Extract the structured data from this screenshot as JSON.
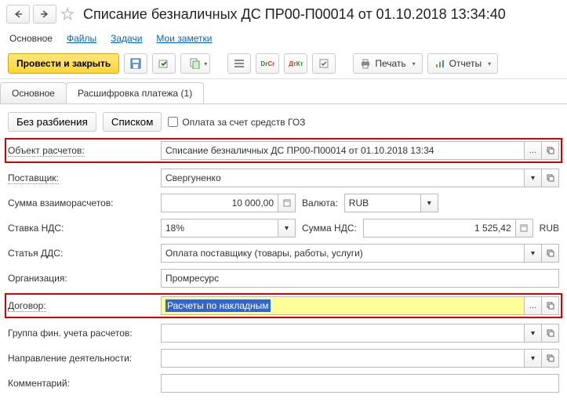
{
  "header": {
    "title": "Списание безналичных ДС ПР00-П00014 от 01.10.2018 13:34:40"
  },
  "nav": {
    "main": "Основное",
    "files": "Файлы",
    "tasks": "Задачи",
    "notes": "Мои заметки"
  },
  "actions": {
    "post_close": "Провести и закрыть",
    "print": "Печать",
    "reports": "Отчеты"
  },
  "tabs": {
    "main": "Основное",
    "payment_details": "Расшифровка платежа (1)"
  },
  "modes": {
    "no_split": "Без разбиения",
    "list": "Списком",
    "goz_checkbox": "Оплата за счет средств ГОЗ"
  },
  "fields": {
    "settlement_object": {
      "label": "Объект расчетов:",
      "value": "Списание безналичных ДС ПР00-П00014 от 01.10.2018 13:34"
    },
    "supplier": {
      "label": "Поставщик:",
      "value": "Свергуненко"
    },
    "settlement_amount": {
      "label": "Сумма взаиморасчетов:",
      "value": "10 000,00"
    },
    "currency": {
      "label": "Валюта:",
      "value": "RUB"
    },
    "vat_rate": {
      "label": "Ставка НДС:",
      "value": "18%"
    },
    "vat_amount": {
      "label": "Сумма НДС:",
      "value": "1 525,42"
    },
    "vat_currency": "RUB",
    "dds_item": {
      "label": "Статья ДДС:",
      "value": "Оплата поставщику (товары, работы, услуги)"
    },
    "organization": {
      "label": "Организация:",
      "value": "Промресурс"
    },
    "contract": {
      "label": "Договор:",
      "value": "Расчеты по накладным"
    },
    "fin_group": {
      "label": "Группа фин. учета расчетов:",
      "value": ""
    },
    "activity": {
      "label": "Направление деятельности:",
      "value": ""
    },
    "comment": {
      "label": "Комментарий:",
      "value": ""
    }
  }
}
